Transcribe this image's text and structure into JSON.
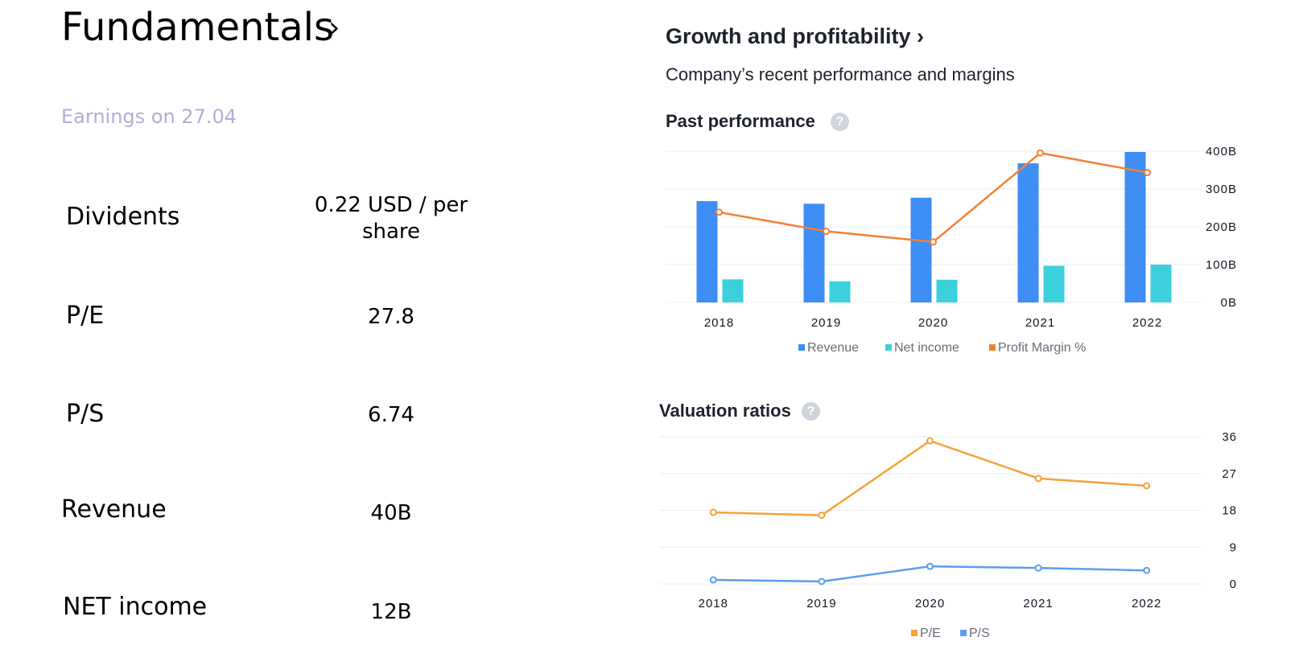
{
  "fundamentals": {
    "title": "Fundamentals",
    "chevron": "›",
    "earnings": "Earnings on 27.04",
    "rows": [
      {
        "label": "Dividents",
        "value": "0.22 USD / per share"
      },
      {
        "label": "P/E",
        "value": "27.8"
      },
      {
        "label": "P/S",
        "value": "6.74"
      },
      {
        "label": "Revenue",
        "value": "40B"
      },
      {
        "label": "NET income",
        "value": "12B"
      }
    ]
  },
  "growth": {
    "title": "Growth and profitability ›",
    "subtitle": "Company’s recent performance and margins",
    "past_title": "Past performance",
    "valuation_title": "Valuation ratios",
    "help": "?"
  },
  "colors": {
    "revenue": "#3d8ef5",
    "net_income": "#3ccfdc",
    "profit_margin": "#f57f33",
    "pe": "#f7a23b",
    "ps": "#5b9ef0"
  },
  "chart_data": [
    {
      "type": "bar",
      "title": "Past performance",
      "categories": [
        "2018",
        "2019",
        "2020",
        "2021",
        "2022"
      ],
      "series": [
        {
          "name": "Revenue",
          "kind": "bar",
          "values": [
            268,
            261,
            277,
            368,
            398
          ]
        },
        {
          "name": "Net income",
          "kind": "bar",
          "values": [
            61,
            56,
            60,
            97,
            100
          ]
        },
        {
          "name": "Profit Margin %",
          "kind": "line",
          "axis": "secondary",
          "values": [
            22.7,
            12.0,
            6.0,
            56.0,
            45.0
          ]
        }
      ],
      "y_ticks": [
        "0B",
        "100B",
        "200B",
        "300B",
        "400B"
      ],
      "ylim": [
        0,
        400
      ],
      "y2lim": [
        -28,
        57
      ],
      "grid": true,
      "legend_position": "bottom"
    },
    {
      "type": "line",
      "title": "Valuation ratios",
      "categories": [
        "2018",
        "2019",
        "2020",
        "2021",
        "2022"
      ],
      "series": [
        {
          "name": "P/E",
          "values": [
            17.5,
            16.8,
            35.0,
            25.8,
            24.0
          ]
        },
        {
          "name": "P/S",
          "values": [
            1.0,
            0.6,
            4.3,
            3.9,
            3.3
          ]
        }
      ],
      "y_ticks": [
        "0",
        "9",
        "18",
        "27",
        "36"
      ],
      "ylim": [
        0,
        36
      ],
      "grid": true,
      "legend_position": "bottom"
    }
  ]
}
